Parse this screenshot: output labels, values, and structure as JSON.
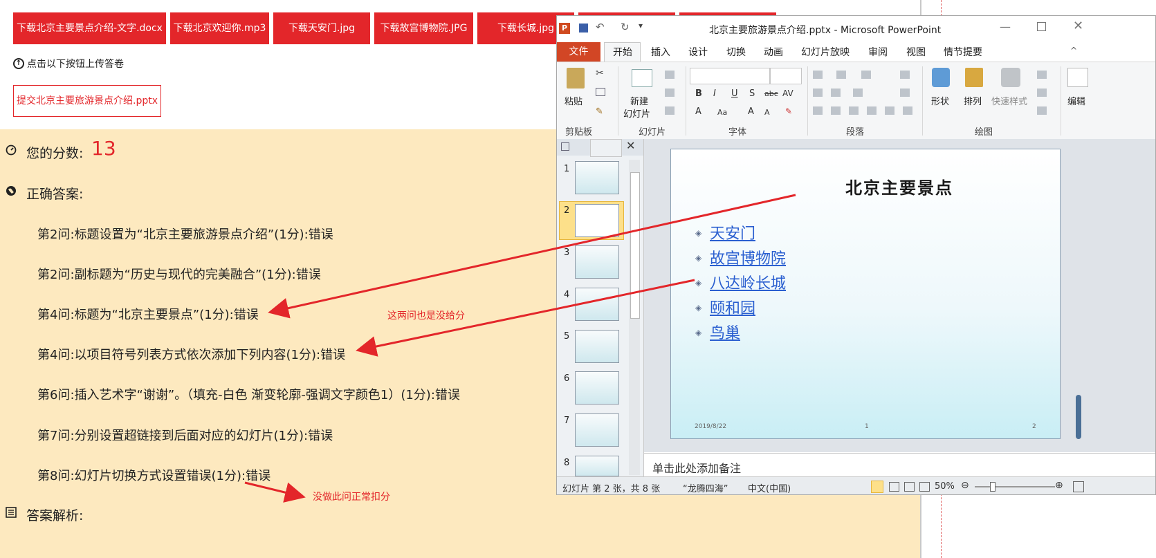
{
  "downloads": [
    "下载北京主要景点介绍-文字.docx",
    "下载北京欢迎你.mp3",
    "下载天安门.jpg",
    "下载故宫博物院.JPG",
    "下载长城.jpg"
  ],
  "upload_hint": "点击以下按钮上传答卷",
  "submit_label": "提交北京主要旅游景点介绍.pptx",
  "score": {
    "label": "您的分数:",
    "value": "13"
  },
  "answers": {
    "label": "正确答案:",
    "lines": [
      "第2问:标题设置为“北京主要旅游景点介绍”(1分):错误",
      "第2问:副标题为“历史与现代的完美融合”(1分):错误",
      "第4问:标题为“北京主要景点”(1分):错误",
      "第4问:以项目符号列表方式依次添加下列内容(1分):错误",
      "第6问:插入艺术字“谢谢”。（填充-白色 渐变轮廓-强调文字颜色1）(1分):错误",
      "第7问:分别设置超链接到后面对应的幻灯片(1分):错误",
      "第8问:幻灯片切换方式设置错误(1分):错误"
    ]
  },
  "analysis_label": "答案解析:",
  "annotations": {
    "note1": "这两问也是没给分",
    "note2": "没做此问正常扣分",
    "color": "#e3262a"
  },
  "ppt": {
    "title": "北京主要旅游景点介绍.pptx - Microsoft PowerPoint",
    "file_tab": "文件",
    "tabs": [
      "开始",
      "插入",
      "设计",
      "切换",
      "动画",
      "幻灯片放映",
      "审阅",
      "视图",
      "情节提要"
    ],
    "groups": {
      "clipboard": "剪贴板",
      "slides": "幻灯片",
      "font": "字体",
      "paragraph": "段落",
      "drawing": "绘图",
      "edit": "编辑"
    },
    "buttons": {
      "paste": "粘贴",
      "new_slide_1": "新建",
      "new_slide_2": "幻灯片",
      "shape": "形状",
      "arrange": "排列",
      "quick_style": "快速样式"
    },
    "thumb_numbers": [
      "1",
      "2",
      "3",
      "4",
      "5",
      "6",
      "7",
      "8"
    ],
    "slide": {
      "title": "北京主要景点",
      "bullets": [
        "天安门",
        "故宫博物院",
        "八达岭长城",
        "颐和园",
        "鸟巢"
      ],
      "date": "2019/8/22",
      "footer": "1",
      "page": "2"
    },
    "notes_placeholder": "单击此处添加备注",
    "status": {
      "slide_info": "幻灯片 第 2 张，共 8 张",
      "theme": "“龙腾四海”",
      "language": "中文(中国)",
      "zoom": "50%"
    }
  }
}
